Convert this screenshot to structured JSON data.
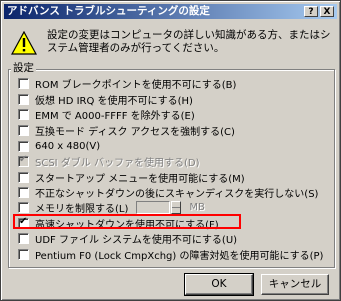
{
  "window": {
    "title": "アドバンス トラブルシューティングの設定",
    "help_glyph": "?",
    "close_glyph": "X"
  },
  "message": "設定の変更はコンピュータの詳しい知識がある方、またはシステム管理者のみが行ってください。",
  "group": {
    "label": "設定",
    "options": [
      {
        "label": "ROM ブレークポイントを使用不可にする(B)",
        "checked": false,
        "enabled": true
      },
      {
        "label": "仮想 HD IRQ を使用不可にする(H)",
        "checked": false,
        "enabled": true
      },
      {
        "label": "EMM で A000-FFFF を除外する(E)",
        "checked": false,
        "enabled": true
      },
      {
        "label": "互換モード ディスク アクセスを強制する(C)",
        "checked": false,
        "enabled": true
      },
      {
        "label": "640 x 480(V)",
        "checked": false,
        "enabled": true
      },
      {
        "label": "SCSI ダブル バッファを使用する(D)",
        "checked": true,
        "enabled": false
      },
      {
        "label": "スタートアップ メニューを使用可能にする(M)",
        "checked": false,
        "enabled": true
      },
      {
        "label": "不正なシャットダウンの後にスキャンディスクを実行しない(S)",
        "checked": false,
        "enabled": true
      },
      {
        "label": "メモリを制限する(L)",
        "checked": false,
        "enabled": true,
        "unit": "MB"
      },
      {
        "label": "高速シャットダウンを使用不可にする(F)",
        "checked": true,
        "enabled": true
      },
      {
        "label": "UDF ファイル システムを使用不可にする(U)",
        "checked": false,
        "enabled": true
      },
      {
        "label": "Pentium F0 (Lock CmpXchg) の障害対処を使用可能にする(P)",
        "checked": false,
        "enabled": true
      }
    ]
  },
  "buttons": {
    "ok": "OK",
    "cancel": "キャンセル"
  },
  "colors": {
    "highlight": "#ff0000",
    "title_start": "#0a246a",
    "title_end": "#a6caf0",
    "face": "#d4d0c8"
  }
}
